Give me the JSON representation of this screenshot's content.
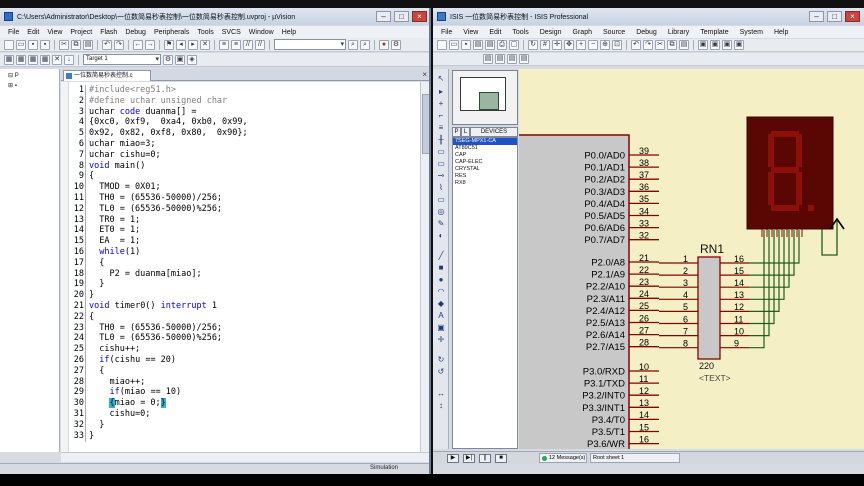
{
  "uvision": {
    "title": "C:\\Users\\Administrator\\Desktop\\一位数简易秒表控制\\一位数简易秒表控制.uvproj - µVision",
    "menu": [
      "File",
      "Edit",
      "View",
      "Project",
      "Flash",
      "Debug",
      "Peripherals",
      "Tools",
      "SVCS",
      "Window",
      "Help"
    ],
    "target": "Target 1",
    "editor_tab": "一位数简易秒表控制.c",
    "status": "Simulation",
    "code": [
      {
        "n": "1",
        "parts": [
          {
            "t": "#include<reg51.h>",
            "c": "pp"
          }
        ]
      },
      {
        "n": "2",
        "parts": [
          {
            "t": "#define uchar unsigned char",
            "c": "pp"
          }
        ]
      },
      {
        "n": "3",
        "parts": [
          {
            "t": "uchar ",
            "c": ""
          },
          {
            "t": "code",
            "c": "kw"
          },
          {
            "t": " duanma[] =",
            "c": ""
          }
        ]
      },
      {
        "n": "4",
        "parts": [
          {
            "t": "{0xc0, 0xf9,  0xa4, 0xb0, 0x99,",
            "c": ""
          }
        ]
      },
      {
        "n": "5",
        "parts": [
          {
            "t": "0x92, 0x82, 0xf8, 0x80,  0x90};",
            "c": ""
          }
        ]
      },
      {
        "n": "6",
        "parts": [
          {
            "t": "uchar miao=3;",
            "c": ""
          }
        ]
      },
      {
        "n": "7",
        "parts": [
          {
            "t": "uchar cishu=0;",
            "c": ""
          }
        ]
      },
      {
        "n": "8",
        "parts": [
          {
            "t": "void",
            "c": "kw"
          },
          {
            "t": " main()",
            "c": ""
          }
        ]
      },
      {
        "n": "9",
        "parts": [
          {
            "t": "{",
            "c": ""
          }
        ]
      },
      {
        "n": "10",
        "parts": [
          {
            "t": "  TMOD = 0X01;",
            "c": ""
          }
        ]
      },
      {
        "n": "11",
        "parts": [
          {
            "t": "  TH0 = (65536-50000)/256;",
            "c": ""
          }
        ]
      },
      {
        "n": "12",
        "parts": [
          {
            "t": "  TL0 = (65536-50000)%256;",
            "c": ""
          }
        ]
      },
      {
        "n": "13",
        "parts": [
          {
            "t": "  TR0 = 1;",
            "c": ""
          }
        ]
      },
      {
        "n": "14",
        "parts": [
          {
            "t": "  ET0 = 1;",
            "c": ""
          }
        ]
      },
      {
        "n": "15",
        "parts": [
          {
            "t": "  EA  = 1;",
            "c": ""
          }
        ]
      },
      {
        "n": "16",
        "parts": [
          {
            "t": "  ",
            "c": ""
          },
          {
            "t": "while",
            "c": "kw"
          },
          {
            "t": "(1)",
            "c": ""
          }
        ]
      },
      {
        "n": "17",
        "parts": [
          {
            "t": "  {",
            "c": ""
          }
        ]
      },
      {
        "n": "18",
        "parts": [
          {
            "t": "    P2 = duanma[miao];",
            "c": ""
          }
        ]
      },
      {
        "n": "19",
        "parts": [
          {
            "t": "  }",
            "c": ""
          }
        ]
      },
      {
        "n": "20",
        "parts": [
          {
            "t": "}",
            "c": ""
          }
        ]
      },
      {
        "n": "21",
        "parts": [
          {
            "t": "void",
            "c": "kw"
          },
          {
            "t": " timer0() ",
            "c": ""
          },
          {
            "t": "interrupt",
            "c": "kw"
          },
          {
            "t": " 1",
            "c": ""
          }
        ]
      },
      {
        "n": "22",
        "parts": [
          {
            "t": "{",
            "c": ""
          }
        ]
      },
      {
        "n": "23",
        "parts": [
          {
            "t": "  TH0 = (65536-50000)/256;",
            "c": ""
          }
        ]
      },
      {
        "n": "24",
        "parts": [
          {
            "t": "  TL0 = (65536-50000)%256;",
            "c": ""
          }
        ]
      },
      {
        "n": "25",
        "parts": [
          {
            "t": "  cishu++;",
            "c": ""
          }
        ]
      },
      {
        "n": "26",
        "parts": [
          {
            "t": "  ",
            "c": ""
          },
          {
            "t": "if",
            "c": "kw"
          },
          {
            "t": "(cishu == 20)",
            "c": ""
          }
        ]
      },
      {
        "n": "27",
        "parts": [
          {
            "t": "  {",
            "c": ""
          }
        ]
      },
      {
        "n": "28",
        "parts": [
          {
            "t": "    miao++;",
            "c": ""
          }
        ]
      },
      {
        "n": "29",
        "parts": [
          {
            "t": "    ",
            "c": ""
          },
          {
            "t": "if",
            "c": "kw"
          },
          {
            "t": "(miao == 10)",
            "c": ""
          }
        ]
      },
      {
        "n": "30",
        "parts": [
          {
            "t": "    ",
            "c": ""
          },
          {
            "t": "{",
            "c": "sel"
          },
          {
            "t": "miao = 0;",
            "c": ""
          },
          {
            "t": "}",
            "c": "sel"
          }
        ]
      },
      {
        "n": "31",
        "parts": [
          {
            "t": "    cishu=0;",
            "c": ""
          }
        ]
      },
      {
        "n": "32",
        "parts": [
          {
            "t": "  }",
            "c": ""
          }
        ]
      },
      {
        "n": "33",
        "parts": [
          {
            "t": "}",
            "c": ""
          }
        ]
      }
    ]
  },
  "isis": {
    "title": "ISIS 一位数简易秒表控制 - ISIS Professional",
    "menu": [
      "File",
      "View",
      "Edit",
      "Tools",
      "Design",
      "Graph",
      "Source",
      "Debug",
      "Library",
      "Template",
      "System",
      "Help"
    ],
    "dev_tabs": [
      "P",
      "L",
      "DEVICES"
    ],
    "devices": [
      "7SEG-MPX1-CA",
      "AT89C51",
      "CAP",
      "CAP-ELEC",
      "CRYSTAL",
      "RES",
      "RX8"
    ],
    "selected_device": 0,
    "messages": "12 Message(s)",
    "sheet": "Root sheet 1",
    "mcu_pins": [
      {
        "label": "P0.0/AD0",
        "num": "39"
      },
      {
        "label": "P0.1/AD1",
        "num": "38"
      },
      {
        "label": "P0.2/AD2",
        "num": "37"
      },
      {
        "label": "P0.3/AD3",
        "num": "36"
      },
      {
        "label": "P0.4/AD4",
        "num": "35"
      },
      {
        "label": "P0.5/AD5",
        "num": "34"
      },
      {
        "label": "P0.6/AD6",
        "num": "33"
      },
      {
        "label": "P0.7/AD7",
        "num": "32"
      },
      {
        "label": "P2.0/A8",
        "num": "21"
      },
      {
        "label": "P2.1/A9",
        "num": "22"
      },
      {
        "label": "P2.2/A10",
        "num": "23"
      },
      {
        "label": "P2.3/A11",
        "num": "24"
      },
      {
        "label": "P2.4/A12",
        "num": "25"
      },
      {
        "label": "P2.5/A13",
        "num": "26"
      },
      {
        "label": "P2.6/A14",
        "num": "27"
      },
      {
        "label": "P2.7/A15",
        "num": "28"
      },
      {
        "label": "P3.0/RXD",
        "num": "10"
      },
      {
        "label": "P3.1/TXD",
        "num": "11"
      },
      {
        "label": "P3.2/INT0",
        "num": "12"
      },
      {
        "label": "P3.3/INT1",
        "num": "13"
      },
      {
        "label": "P3.4/T0",
        "num": "14"
      },
      {
        "label": "P3.5/T1",
        "num": "15"
      },
      {
        "label": "P3.6/WR",
        "num": "16"
      }
    ],
    "rn": {
      "name": "RN1",
      "left_pins": [
        "1",
        "2",
        "3",
        "4",
        "5",
        "6",
        "7",
        "8"
      ],
      "right_pins": [
        "16",
        "15",
        "14",
        "13",
        "12",
        "11",
        "10",
        "9"
      ],
      "value": "220",
      "text": "<TEXT>"
    }
  },
  "colors": {
    "editor_bg": "#ffffff",
    "keyword": "#0000ee",
    "preprocessor": "#808080",
    "bracket_highlight": "#27b7d4",
    "schematic_bg": "#f4efc4",
    "component_body": "#c8c8c8",
    "pin_wire": "#8b0000",
    "net_wire": "#1d5e1d",
    "seg_off": "#8c0f08",
    "seg_bg": "#5a0703"
  }
}
